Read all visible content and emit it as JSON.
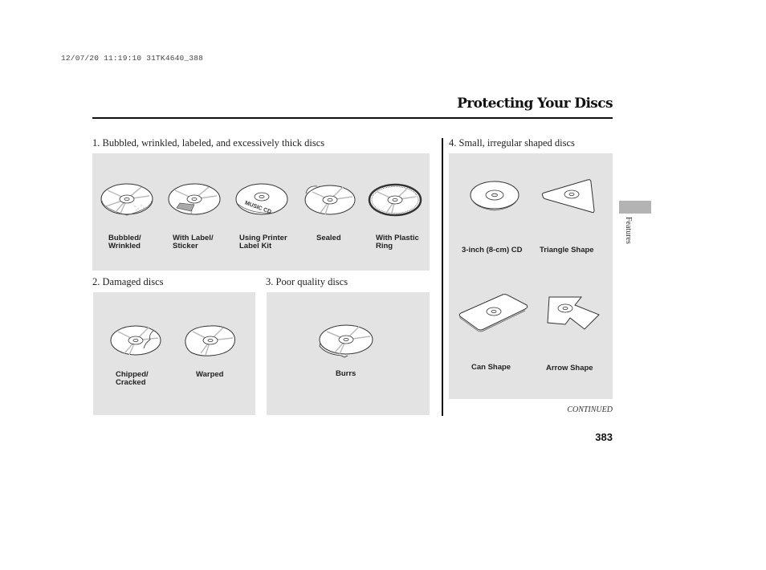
{
  "header": {
    "print_stamp": "12/07/20 11:19:10 31TK4640_388",
    "title": "Protecting Your Discs"
  },
  "side_tab": {
    "label": "Features"
  },
  "sections": [
    {
      "heading": "1. Bubbled, wrinkled, labeled, and excessively thick discs",
      "items": [
        {
          "icon": "bubbled-disc-icon",
          "label": "Bubbled/\nWrinkled"
        },
        {
          "icon": "labeled-disc-icon",
          "label": "With Label/\nSticker"
        },
        {
          "icon": "printer-label-disc-icon",
          "label": "Using Printer\nLabel Kit",
          "disc_text": "MUSIC CD"
        },
        {
          "icon": "sealed-disc-icon",
          "label": "Sealed"
        },
        {
          "icon": "plastic-ring-disc-icon",
          "label": "With Plastic\nRing"
        }
      ]
    },
    {
      "heading": "2. Damaged discs",
      "items": [
        {
          "icon": "cracked-disc-icon",
          "label": "Chipped/\nCracked"
        },
        {
          "icon": "warped-disc-icon",
          "label": "Warped"
        }
      ]
    },
    {
      "heading": "3. Poor quality discs",
      "items": [
        {
          "icon": "burred-disc-icon",
          "label": "Burrs"
        }
      ]
    },
    {
      "heading": "4. Small, irregular shaped discs",
      "items": [
        {
          "icon": "small-cd-icon",
          "label": "3-inch (8-cm) CD"
        },
        {
          "icon": "triangle-disc-icon",
          "label": "Triangle Shape"
        },
        {
          "icon": "can-shape-disc-icon",
          "label": "Can Shape"
        },
        {
          "icon": "arrow-shape-disc-icon",
          "label": "Arrow Shape"
        }
      ]
    }
  ],
  "footer": {
    "continued": "CONTINUED",
    "page_number": "383"
  }
}
